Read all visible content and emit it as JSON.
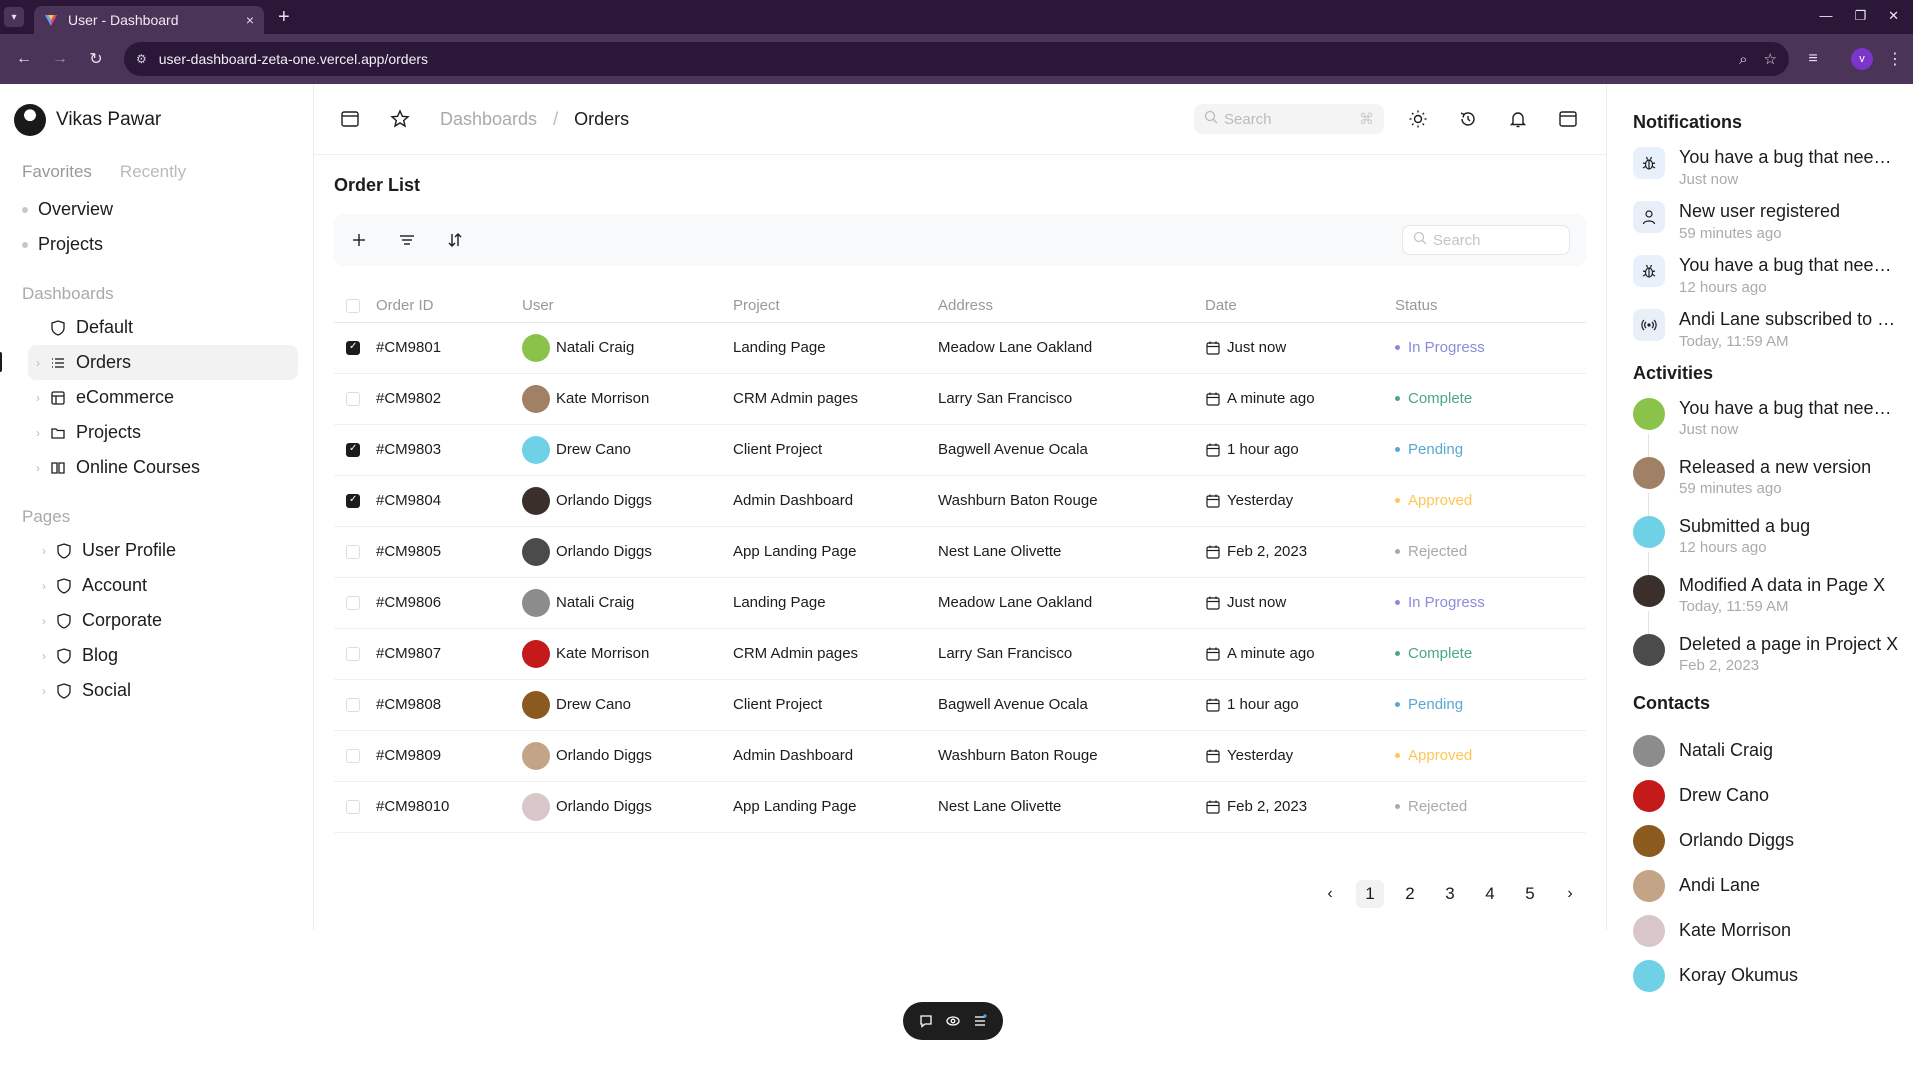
{
  "browser": {
    "tab_title": "User - Dashboard",
    "url": "user-dashboard-zeta-one.vercel.app/orders",
    "profile_initial": "v",
    "new_tab": "+",
    "close_tab": "×"
  },
  "sidebar": {
    "user_name": "Vikas Pawar",
    "tabs": [
      "Favorites",
      "Recently"
    ],
    "favorites": [
      "Overview",
      "Projects"
    ],
    "dashboards_title": "Dashboards",
    "dashboards": [
      {
        "label": "Default",
        "icon": "shield-icon"
      },
      {
        "label": "Orders",
        "icon": "list-icon"
      },
      {
        "label": "eCommerce",
        "icon": "layout-icon"
      },
      {
        "label": "Projects",
        "icon": "folder-icon"
      },
      {
        "label": "Online Courses",
        "icon": "book-icon"
      }
    ],
    "pages_title": "Pages",
    "pages": [
      "User Profile",
      "Account",
      "Corporate",
      "Blog",
      "Social"
    ]
  },
  "topbar": {
    "crumb_parent": "Dashboards",
    "crumb_sep": "/",
    "crumb_current": "Orders",
    "search_placeholder": "Search"
  },
  "orders": {
    "title": "Order List",
    "search_placeholder": "Search",
    "columns": [
      "Order ID",
      "User",
      "Project",
      "Address",
      "Date",
      "Status"
    ],
    "rows": [
      {
        "checked": true,
        "id": "#CM9801",
        "user": "Natali Craig",
        "av": "#8bc34a",
        "project": "Landing Page",
        "address": "Meadow Lane Oakland",
        "date": "Just now",
        "status": "In Progress",
        "color": "#8a8cd9"
      },
      {
        "checked": false,
        "id": "#CM9802",
        "user": "Kate Morrison",
        "av": "#a08166",
        "project": "CRM Admin pages",
        "address": "Larry San Francisco",
        "date": "A minute ago",
        "status": "Complete",
        "color": "#4aa785"
      },
      {
        "checked": true,
        "id": "#CM9803",
        "user": "Drew Cano",
        "av": "#6fd1e6",
        "project": "Client Project",
        "address": "Bagwell Avenue Ocala",
        "date": "1 hour ago",
        "status": "Pending",
        "color": "#59a8d4"
      },
      {
        "checked": true,
        "id": "#CM9804",
        "user": "Orlando Diggs",
        "av": "#3a2f2a",
        "project": "Admin Dashboard",
        "address": "Washburn Baton Rouge",
        "date": "Yesterday",
        "status": "Approved",
        "color": "#ffc555"
      },
      {
        "checked": false,
        "id": "#CM9805",
        "user": "Orlando Diggs",
        "av": "#4b4b4b",
        "project": "App Landing Page",
        "address": "Nest Lane Olivette",
        "date": "Feb 2, 2023",
        "status": "Rejected",
        "color": "#aaaaaa"
      },
      {
        "checked": false,
        "id": "#CM9806",
        "user": "Natali Craig",
        "av": "#8c8c8c",
        "project": "Landing Page",
        "address": "Meadow Lane Oakland",
        "date": "Just now",
        "status": "In Progress",
        "color": "#8a8cd9"
      },
      {
        "checked": false,
        "id": "#CM9807",
        "user": "Kate Morrison",
        "av": "#c41a1a",
        "project": "CRM Admin pages",
        "address": "Larry San Francisco",
        "date": "A minute ago",
        "status": "Complete",
        "color": "#4aa785"
      },
      {
        "checked": false,
        "id": "#CM9808",
        "user": "Drew Cano",
        "av": "#8a5a1e",
        "project": "Client Project",
        "address": "Bagwell Avenue Ocala",
        "date": "1 hour ago",
        "status": "Pending",
        "color": "#59a8d4"
      },
      {
        "checked": false,
        "id": "#CM9809",
        "user": "Orlando Diggs",
        "av": "#c4a486",
        "project": "Admin Dashboard",
        "address": "Washburn Baton Rouge",
        "date": "Yesterday",
        "status": "Approved",
        "color": "#ffc555"
      },
      {
        "checked": false,
        "id": "#CM98010",
        "user": "Orlando Diggs",
        "av": "#d9c6c8",
        "project": "App Landing Page",
        "address": "Nest Lane Olivette",
        "date": "Feb 2, 2023",
        "status": "Rejected",
        "color": "#aaaaaa"
      }
    ],
    "pages": [
      "1",
      "2",
      "3",
      "4",
      "5"
    ],
    "prev": "‹",
    "next": "›"
  },
  "notifications": {
    "title": "Notifications",
    "items": [
      {
        "text": "You have a bug that needs to be fixed.",
        "time": "Just now",
        "icon": "bug-icon"
      },
      {
        "text": "New user registered",
        "time": "59 minutes ago",
        "icon": "user-icon"
      },
      {
        "text": "You have a bug that needs to be fixed.",
        "time": "12 hours ago",
        "icon": "bug-icon"
      },
      {
        "text": "Andi Lane subscribed to you",
        "time": "Today, 11:59 AM",
        "icon": "broadcast-icon"
      }
    ]
  },
  "activities": {
    "title": "Activities",
    "items": [
      {
        "text": "You have a bug that needs to be fixed.",
        "time": "Just now",
        "av": "#8bc34a"
      },
      {
        "text": "Released a new version",
        "time": "59 minutes ago",
        "av": "#a08166"
      },
      {
        "text": "Submitted a bug",
        "time": "12 hours ago",
        "av": "#6fd1e6"
      },
      {
        "text": "Modified A data in Page X",
        "time": "Today, 11:59 AM",
        "av": "#3a2f2a"
      },
      {
        "text": "Deleted a page in Project X",
        "time": "Feb 2, 2023",
        "av": "#4b4b4b"
      }
    ]
  },
  "contacts": {
    "title": "Contacts",
    "items": [
      {
        "name": "Natali Craig",
        "av": "#8c8c8c"
      },
      {
        "name": "Drew Cano",
        "av": "#c41a1a"
      },
      {
        "name": "Orlando Diggs",
        "av": "#8a5a1e"
      },
      {
        "name": "Andi Lane",
        "av": "#c4a486"
      },
      {
        "name": "Kate Morrison",
        "av": "#d9c6c8"
      },
      {
        "name": "Koray Okumus",
        "av": "#6fd1e6"
      }
    ]
  }
}
